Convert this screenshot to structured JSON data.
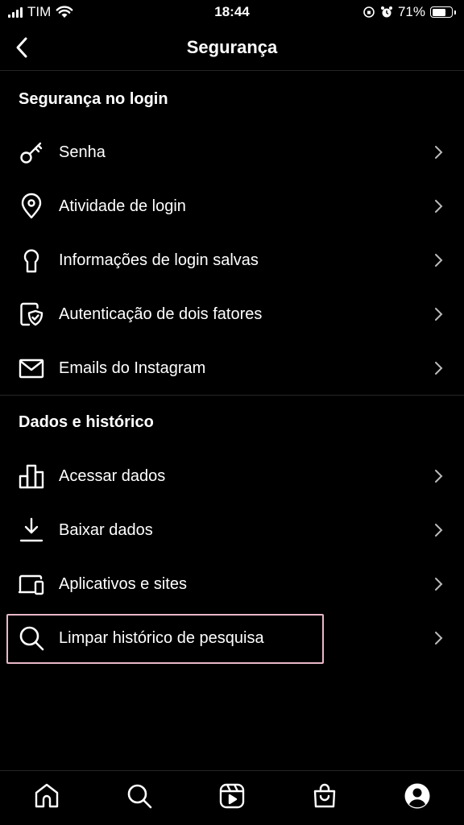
{
  "status_bar": {
    "carrier": "TIM",
    "time": "18:44",
    "battery": "71%",
    "battery_level": 0.71
  },
  "header": {
    "title": "Segurança"
  },
  "sections": [
    {
      "heading": "Segurança no login",
      "items": [
        {
          "label": "Senha",
          "icon": "key-icon"
        },
        {
          "label": "Atividade de login",
          "icon": "location-pin-icon"
        },
        {
          "label": "Informações de login salvas",
          "icon": "keyhole-icon"
        },
        {
          "label": "Autenticação de dois fatores",
          "icon": "shield-phone-icon"
        },
        {
          "label": "Emails do Instagram",
          "icon": "mail-icon"
        }
      ]
    },
    {
      "heading": "Dados e histórico",
      "items": [
        {
          "label": "Acessar dados",
          "icon": "bar-chart-icon"
        },
        {
          "label": "Baixar dados",
          "icon": "download-icon"
        },
        {
          "label": "Aplicativos e sites",
          "icon": "devices-icon"
        },
        {
          "label": "Limpar histórico de pesquisa",
          "icon": "search-icon"
        }
      ]
    }
  ],
  "tabbar": {
    "tabs": [
      "home-icon",
      "search-icon",
      "reels-icon",
      "shop-icon",
      "profile-icon"
    ]
  },
  "colors": {
    "background": "#000000",
    "text": "#ffffff",
    "divider": "#262626",
    "highlight": "#e8b8c8"
  }
}
